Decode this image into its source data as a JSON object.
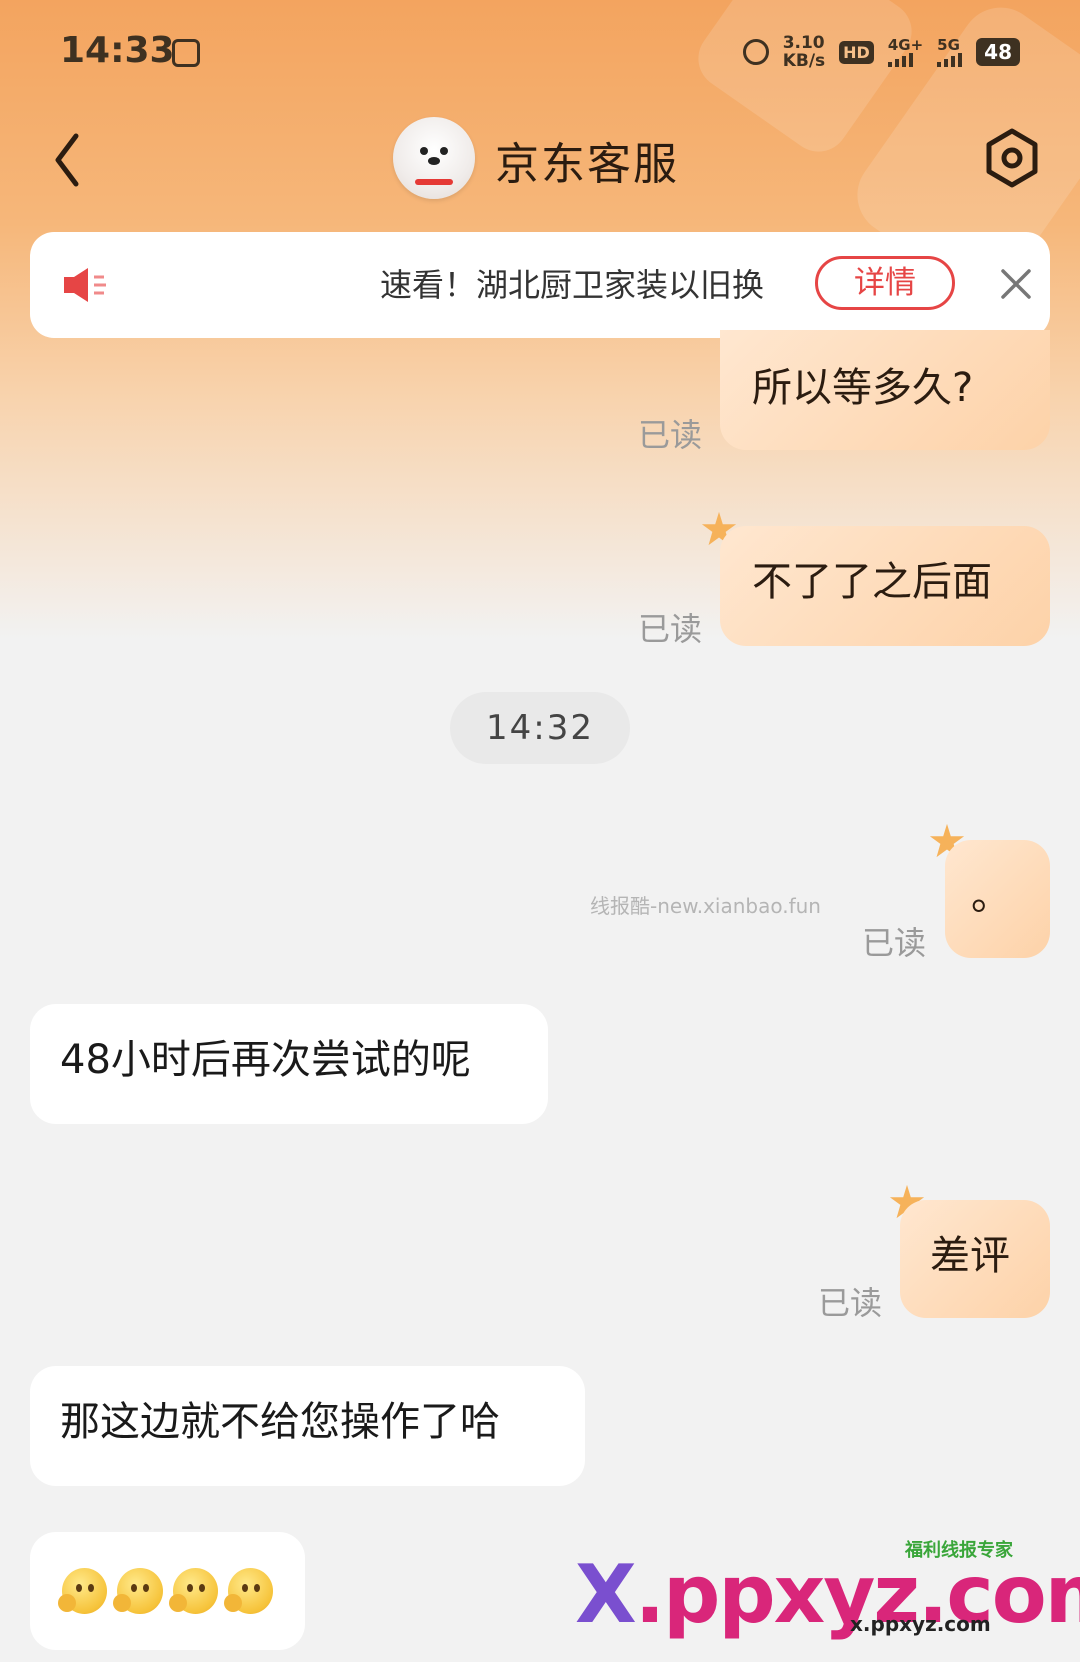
{
  "status_bar": {
    "time": "14:33",
    "net_speed_value": "3.10",
    "net_speed_unit": "KB/s",
    "hd_badge": "HD",
    "signal_1": "4G+",
    "signal_2": "5G",
    "battery": "48"
  },
  "header": {
    "title": "京东客服"
  },
  "notice": {
    "text": "速看！湖北厨卫家装以旧换",
    "detail_button": "详情"
  },
  "messages": [
    {
      "side": "right",
      "text": "所以等多久?",
      "status": "已读"
    },
    {
      "side": "right",
      "text": "不了了之后面",
      "status": "已读"
    },
    {
      "type": "time",
      "text": "14:32"
    },
    {
      "side": "right",
      "text": "。",
      "status": "已读"
    },
    {
      "side": "left",
      "text": "48小时后再次尝试的呢"
    },
    {
      "side": "right",
      "text": "差评",
      "status": "已读"
    },
    {
      "side": "left",
      "text": "那这边就不给您操作了哈"
    },
    {
      "side": "left",
      "type": "emoji",
      "count": 4
    }
  ],
  "watermarks": {
    "small": "线报酷-new.xianbao.fun",
    "logo_x": "X",
    "logo_rest": ".ppxyz.com",
    "tag": "福利线报专家",
    "url": "x.ppxyz.com"
  },
  "colors": {
    "header_gradient_top": "#f3a45f",
    "bubble_right": "#fdd2a8",
    "bubble_left": "#ffffff",
    "accent_red": "#e64545",
    "background": "#f2f2f2"
  },
  "icons": [
    "back-icon",
    "avatar",
    "settings-icon",
    "speaker-icon",
    "close-icon",
    "star-icon",
    "emoji-icon"
  ]
}
